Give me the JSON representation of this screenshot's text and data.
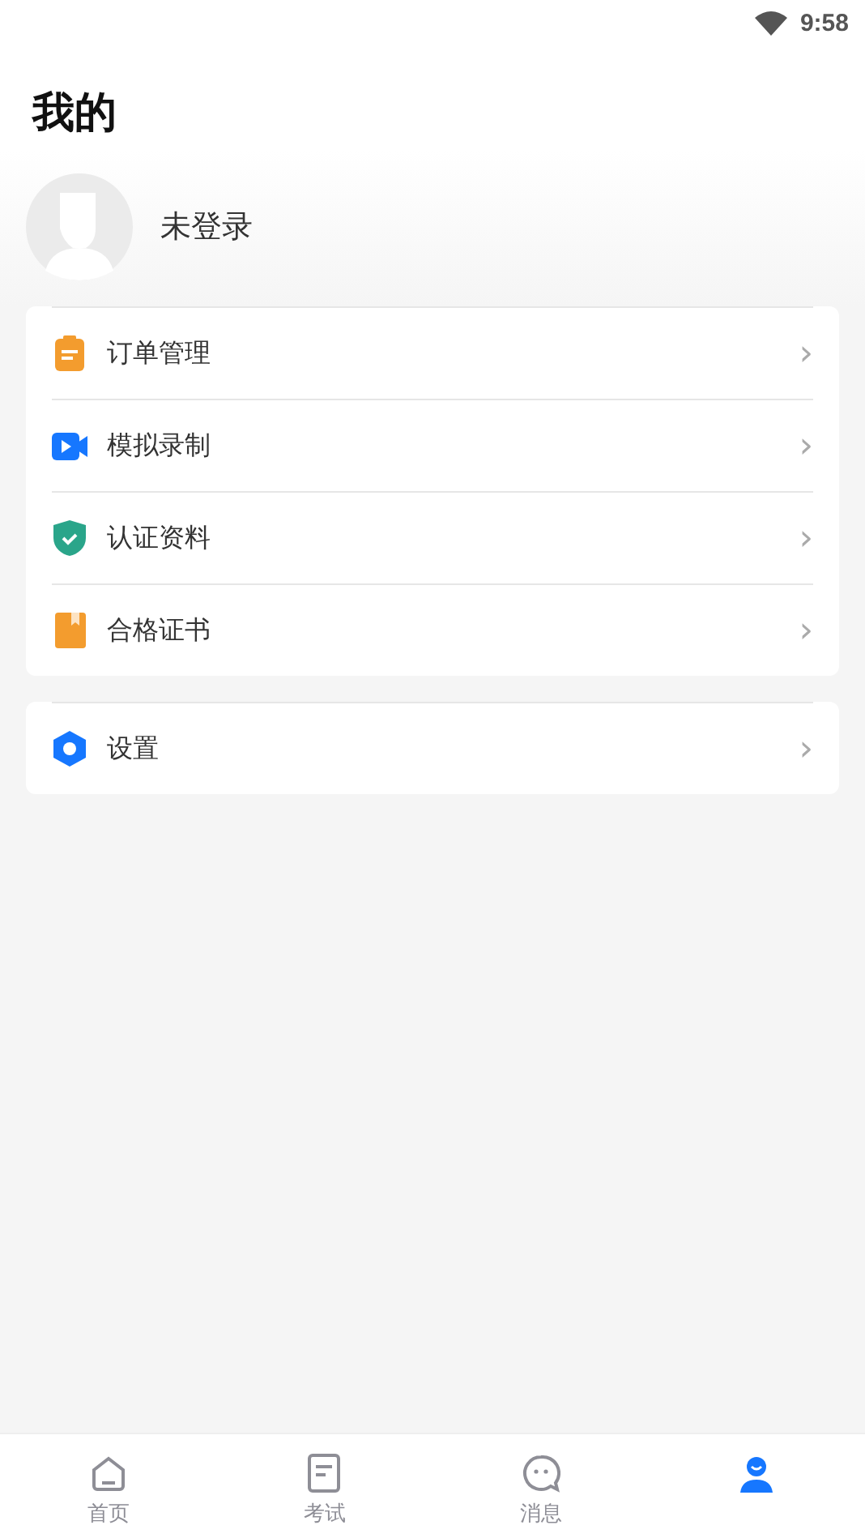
{
  "status_bar": {
    "time": "9:58"
  },
  "header": {
    "title": "我的"
  },
  "profile": {
    "name": "未登录"
  },
  "menu_groups": [
    {
      "items": [
        {
          "label": "订单管理",
          "kind": "clipboard",
          "chevron": "›"
        },
        {
          "label": "模拟录制",
          "kind": "video",
          "chevron": "›"
        },
        {
          "label": "认证资料",
          "kind": "shield",
          "chevron": "›"
        },
        {
          "label": "合格证书",
          "kind": "book",
          "chevron": "›"
        }
      ]
    },
    {
      "items": [
        {
          "label": "设置",
          "kind": "settings",
          "chevron": "›"
        }
      ]
    }
  ],
  "tab_bar": [
    {
      "label": "首页",
      "kind": "home",
      "selected": false
    },
    {
      "label": "考试",
      "kind": "exam",
      "selected": false
    },
    {
      "label": "消息",
      "kind": "message",
      "selected": false
    },
    {
      "kind": "profile",
      "selected": true
    }
  ]
}
